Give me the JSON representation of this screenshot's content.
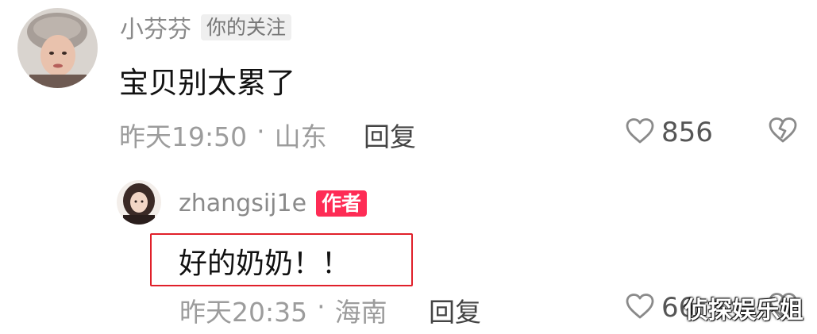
{
  "comments": [
    {
      "username": "小芬芬",
      "tag": "你的关注",
      "text": "宝贝别太累了",
      "time": "昨天19:50",
      "separator": "·",
      "location": "山东",
      "reply_label": "回复",
      "likes": "856"
    },
    {
      "username": "zhangsij1e",
      "tag": "作者",
      "text": "好的奶奶！！",
      "time": "昨天20:35",
      "separator": "·",
      "location": "海南",
      "reply_label": "回复",
      "likes": "66"
    }
  ],
  "watermark": "侦探娱乐姐",
  "colors": {
    "author_tag": "#fe2c55",
    "highlight_box": "#e0202a",
    "meta_text": "#9c9c9c"
  },
  "icons": [
    "heart-outline-icon",
    "broken-heart-icon"
  ]
}
